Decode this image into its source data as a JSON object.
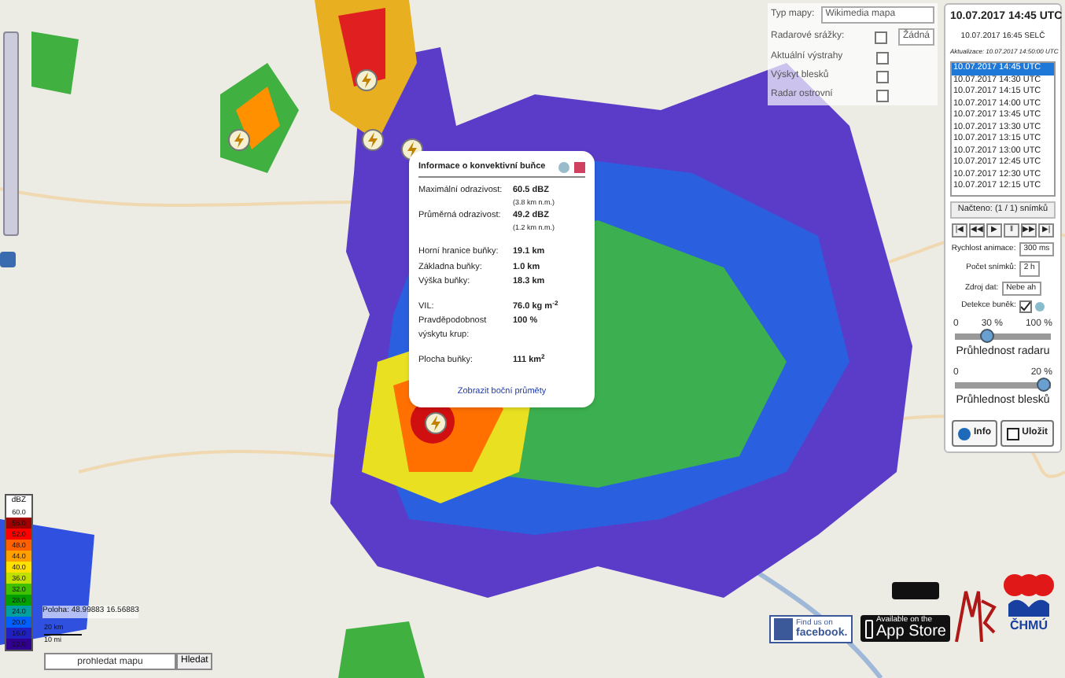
{
  "map_type": {
    "label": "Typ mapy:",
    "value": "Wikimedia mapa"
  },
  "layers": [
    {
      "label": "Radarové srážky:",
      "checked": false,
      "select": "Žádná"
    },
    {
      "label": "Aktuální výstrahy",
      "checked": false
    },
    {
      "label": "Výskyt blesků",
      "checked": false
    },
    {
      "label": "Radar ostrovní",
      "checked": false
    }
  ],
  "cell_popup": {
    "title": "Informace o konvektivní buňce",
    "groups": [
      [
        {
          "label": "Maximální odrazivost:",
          "value": "60.5 dBZ",
          "note": "(3.8 km n.m.)"
        },
        {
          "label": "Průměrná odrazivost:",
          "value": "49.2 dBZ",
          "note": "(1.2 km n.m.)"
        }
      ],
      [
        {
          "label": "Horní hranice buňky:",
          "value": "19.1 km"
        },
        {
          "label": "Základna buňky:",
          "value": "1.0 km"
        },
        {
          "label": "Výška buňky:",
          "value": "18.3 km"
        }
      ],
      [
        {
          "label": "VIL:",
          "value": "76.0 kg m$^{-2}$"
        },
        {
          "label": "Pravděpodobnost výskytu krup:",
          "value": "100 %"
        }
      ],
      [
        {
          "label": "Plocha buňky:",
          "value": "111 km$^{2}$"
        }
      ]
    ],
    "link": "Zobrazit boční průměty"
  },
  "legend": {
    "unit": "dBZ",
    "steps": [
      {
        "label": "60.0",
        "color": "#ffffff"
      },
      {
        "label": "56.0",
        "color": "#a00000"
      },
      {
        "label": "52.0",
        "color": "#ff0000"
      },
      {
        "label": "48.0",
        "color": "#ff6000"
      },
      {
        "label": "44.0",
        "color": "#ffa000"
      },
      {
        "label": "40.0",
        "color": "#ffe000"
      },
      {
        "label": "36.0",
        "color": "#c0e000"
      },
      {
        "label": "32.0",
        "color": "#40c000"
      },
      {
        "label": "28.0",
        "color": "#00a000"
      },
      {
        "label": "24.0",
        "color": "#00a0a0"
      },
      {
        "label": "20.0",
        "color": "#0060ff"
      },
      {
        "label": "16.0",
        "color": "#2020c0"
      },
      {
        "label": "12.0",
        "color": "#300090"
      }
    ]
  },
  "position": "Poloha: 48.99883 16.56883",
  "scale": [
    "20 km",
    "10 mi"
  ],
  "search": {
    "placeholder": "prohledat mapu",
    "button": "Hledat"
  },
  "panel": {
    "time_utc": "10.07.2017 14:45 UTC",
    "time_local": "10.07.2017 16:45 SELČ",
    "updated": "Aktualizace: 10.07.2017 14:50:00 UTC",
    "times": [
      {
        "label": "10.07.2017 14:45 UTC",
        "selected": true
      },
      {
        "label": "10.07.2017 14:30 UTC",
        "selected": false
      },
      {
        "label": "10.07.2017 14:15 UTC",
        "selected": false
      },
      {
        "label": "10.07.2017 14:00 UTC",
        "selected": false
      },
      {
        "label": "10.07.2017 13:45 UTC",
        "selected": false
      },
      {
        "label": "10.07.2017 13:30 UTC",
        "selected": false
      },
      {
        "label": "10.07.2017 13:15 UTC",
        "selected": false
      },
      {
        "label": "10.07.2017 13:00 UTC",
        "selected": false
      },
      {
        "label": "10.07.2017 12:45 UTC",
        "selected": false
      },
      {
        "label": "10.07.2017 12:30 UTC",
        "selected": false
      },
      {
        "label": "10.07.2017 12:15 UTC",
        "selected": false
      }
    ],
    "loaded": "Načteno: (1 / 1) snímků",
    "player": [
      "|◀",
      "◀◀",
      "▶",
      "‖",
      "▶▶",
      "▶|"
    ],
    "speed": {
      "label": "Rychlost animace:",
      "value": "300 ms"
    },
    "frames": {
      "label": "Počet snímků:",
      "value": "2 h"
    },
    "source": {
      "label": "Zdroj dat:",
      "value": "Nebe ah"
    },
    "detection": {
      "label": "Detekce buněk:",
      "checked": true
    },
    "radar_opacity": {
      "min": "0",
      "reading": "30 %",
      "max": "100 %",
      "level": 0.3,
      "caption": "Průhlednost radaru"
    },
    "lightning_opacity": {
      "min": "0",
      "reading": "20 %",
      "level": 1,
      "caption": "Průhlednost blesků"
    },
    "buttons": [
      "Info",
      "Uložit"
    ]
  },
  "logos": {
    "facebook_small": "Find us on",
    "facebook": "facebook.",
    "appstore_small": "Available on the",
    "appstore": "App Store",
    "chmu": "ČHMÚ"
  }
}
